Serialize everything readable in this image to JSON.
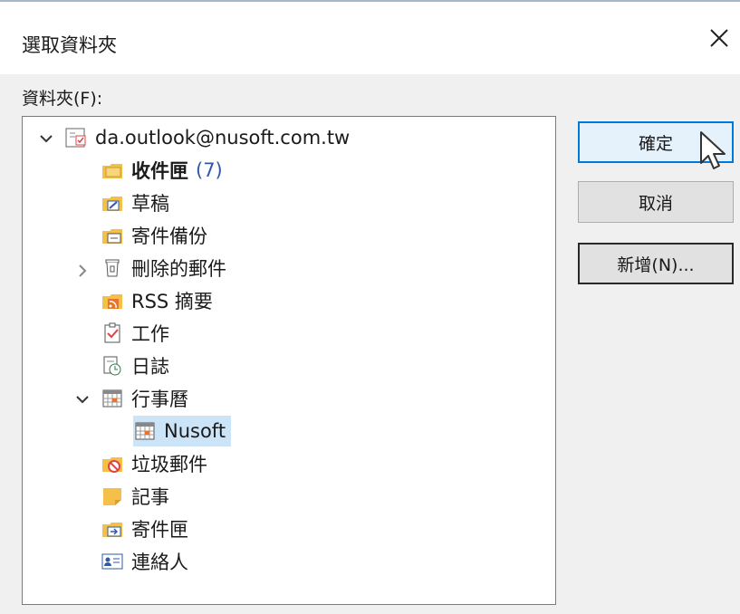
{
  "dialog": {
    "title": "選取資料夾",
    "folder_label": "資料夾(F):"
  },
  "tree": {
    "account": "da.outlook@nusoft.com.tw",
    "items": [
      {
        "label": "收件匣",
        "count": "(7)",
        "icon": "inbox-folder-icon"
      },
      {
        "label": "草稿",
        "icon": "drafts-folder-icon"
      },
      {
        "label": "寄件備份",
        "icon": "sent-items-folder-icon"
      },
      {
        "label": "刪除的郵件",
        "icon": "deleted-items-icon"
      },
      {
        "label": "RSS 摘要",
        "icon": "rss-folder-icon"
      },
      {
        "label": "工作",
        "icon": "tasks-icon"
      },
      {
        "label": "日誌",
        "icon": "journal-icon"
      },
      {
        "label": "行事曆",
        "icon": "calendar-icon"
      },
      {
        "label": "Nusoft",
        "icon": "calendar-icon"
      },
      {
        "label": "垃圾郵件",
        "icon": "junk-folder-icon"
      },
      {
        "label": "記事",
        "icon": "notes-icon"
      },
      {
        "label": "寄件匣",
        "icon": "outbox-folder-icon"
      },
      {
        "label": "連絡人",
        "icon": "contacts-icon"
      }
    ]
  },
  "buttons": {
    "ok": "確定",
    "cancel": "取消",
    "new": "新增(N)..."
  },
  "colors": {
    "accent": "#0078d7",
    "selection": "#cce4f7",
    "count": "#2f5aa8",
    "folder": "#f5c04a"
  }
}
